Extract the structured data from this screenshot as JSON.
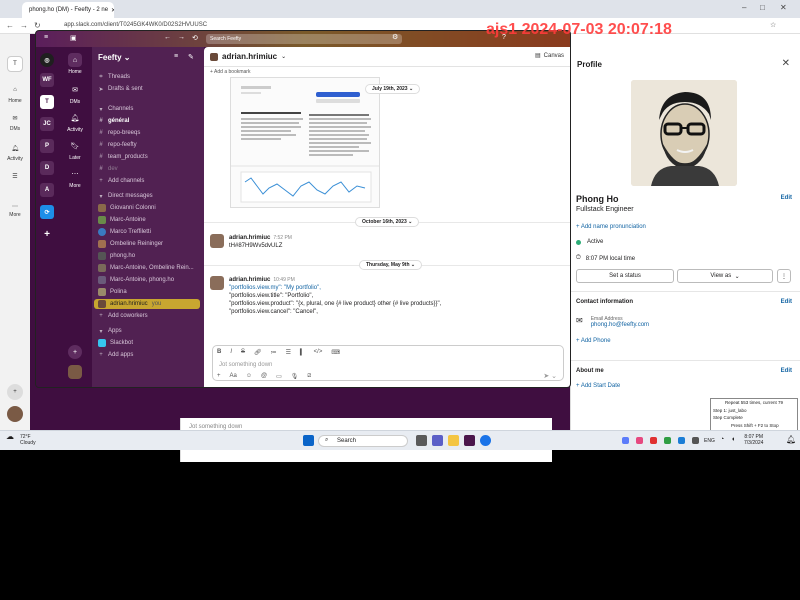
{
  "browser": {
    "tab_title": "phong.ho (DM) - Feefty - 2 ne",
    "url": "app.slack.com/client/T0245GK4WK0/D02S2HVUUSC"
  },
  "watermark": "ajs1 2024-07-03 20:07:18",
  "topbar": {
    "search_placeholder": "Search Feefty"
  },
  "rail": {
    "workspaces": [
      "WF",
      "T",
      "JC",
      "P",
      "D",
      "A"
    ]
  },
  "leftnav": [
    {
      "label": "Home",
      "icon": "home-icon"
    },
    {
      "label": "DMs",
      "icon": "dms-icon"
    },
    {
      "label": "Activity",
      "icon": "bell-icon"
    },
    {
      "label": "Later",
      "icon": "bookmark-icon"
    },
    {
      "label": "More",
      "icon": "more-icon"
    }
  ],
  "sidebar": {
    "workspace": "Feefty",
    "top_items": [
      "Threads",
      "Drafts & sent"
    ],
    "channels_header": "Channels",
    "channels": [
      "général",
      "repo-breeqs",
      "repo-feefty",
      "team_products",
      "dev"
    ],
    "add_channels": "Add channels",
    "dm_header": "Direct messages",
    "dms": [
      "Giovanni Colonni",
      "Marc-Antoine",
      "Marco Treffiletti",
      "Ombeline Reininger",
      "phong.ho",
      "Marc-Antoine, Ombeline Rein...",
      "Marc-Antoine, phong.ho",
      "Polina"
    ],
    "selected_dm": "adrian.hrimiuc",
    "you_label": "you",
    "add_coworkers": "Add coworkers",
    "apps_header": "Apps",
    "apps": [
      "Slackbot"
    ],
    "add_apps": "Add apps"
  },
  "channel": {
    "name": "adrian.hrimiuc",
    "canvas": "Canvas",
    "bookmark": "Add a bookmark",
    "dates": [
      "July 19th, 2023",
      "October 16th, 2023",
      "Thursday, May 9th"
    ],
    "messages": [
      {
        "author": "adrian.hrimiuc",
        "time": "7:52 PM",
        "lines": [
          "tH#87H9Wv5dvULZ"
        ]
      },
      {
        "author": "adrian.hrimiuc",
        "time": "10:49 PM",
        "lines": [
          "\"portfolios.view.my\": \"My portfolio\",",
          "\"portfolios.view.title\": \"Portfolio\",",
          "\"portfolios.view.product\": \"{x, plural, one {# live product} other {# live products}}\",",
          "\"portfolios.view.cancel\": \"Cancel\","
        ]
      }
    ],
    "composer_placeholder": "Jot something down"
  },
  "bg_composer_placeholder": "Jot something down",
  "profile": {
    "header": "Profile",
    "name": "Phong Ho",
    "title": "Fullstack Engineer",
    "edit": "Edit",
    "pronunciation": "Add name pronunciation",
    "status": "Active",
    "local_time": "8:07 PM local time",
    "set_status": "Set a status",
    "view_as": "View as",
    "contact_header": "Contact information",
    "email_label": "Email Address",
    "email": "phong.ho@feefty.com",
    "add_phone": "Add Phone",
    "about_header": "About me",
    "add_start": "Add Start Date"
  },
  "popup": {
    "lines": [
      "Repeat 553 times, current 79",
      "Step 1: just_labo",
      "Step Complete",
      "Press Shift + F2 to Stop"
    ]
  },
  "taskbar": {
    "weather_temp": "72°F",
    "weather_desc": "Cloudy",
    "search": "Search",
    "lang": "ENG",
    "time": "8:07 PM",
    "date": "7/3/2024"
  },
  "colors": {
    "accent": "#3f0e40",
    "link": "#1264a3",
    "active": "#2bac76",
    "selected": "#c8a630",
    "watermark": "#ff3b3b"
  }
}
